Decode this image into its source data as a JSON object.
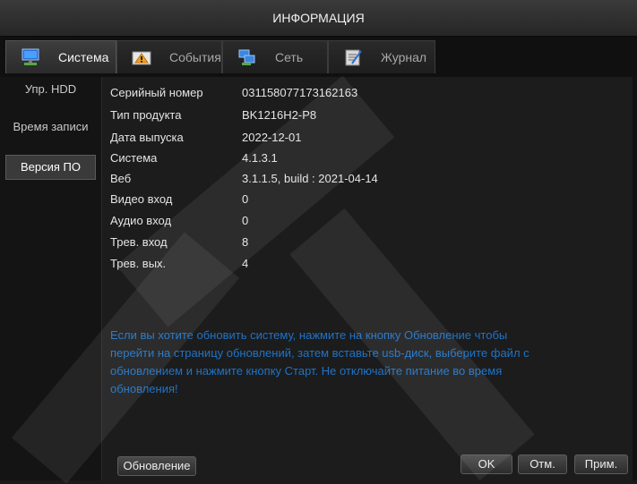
{
  "window": {
    "title": "ИНФОРМАЦИЯ"
  },
  "tabs": [
    {
      "label": "Система",
      "icon": "monitor-icon",
      "active": true
    },
    {
      "label": "События",
      "icon": "alarm-icon",
      "active": false
    },
    {
      "label": "Сеть",
      "icon": "network-icon",
      "active": false
    },
    {
      "label": "Журнал",
      "icon": "log-icon",
      "active": false
    }
  ],
  "sidebar": {
    "items": [
      {
        "label": "Упр. HDD",
        "active": false
      },
      {
        "label": "Время записи",
        "active": false
      },
      {
        "label": "Версия ПО",
        "active": true
      }
    ]
  },
  "info": {
    "rows": [
      {
        "label": "Серийный номер",
        "value": "031158077173162163"
      },
      {
        "label": "Тип продукта",
        "value": "BK1216H2-P8"
      },
      {
        "label": "Дата выпуска",
        "value": "2022-12-01"
      },
      {
        "label": "Система",
        "value": "4.1.3.1"
      },
      {
        "label": "Веб",
        "value": "3.1.1.5, build : 2021-04-14"
      },
      {
        "label": "Видео вход",
        "value": "0"
      },
      {
        "label": "Аудио вход",
        "value": "0"
      },
      {
        "label": "Трев. вход",
        "value": "8"
      },
      {
        "label": "Трев. вых.",
        "value": "4"
      }
    ],
    "notice": "Если вы хотите обновить систему, нажмите на кнопку Обновление чтобы перейти на страницу обновлений, затем вставьте usb-диск, выберите файл с обновлением и нажмите кнопку Старт. Не отключайте питание во время обновления!"
  },
  "buttons": {
    "update": "Обновление",
    "ok": "OK",
    "cancel": "Отм.",
    "apply": "Прим."
  },
  "colors": {
    "notice_text": "#1f73c7",
    "background": "#1c1c1c",
    "active_tab": "#3d3d3d"
  }
}
